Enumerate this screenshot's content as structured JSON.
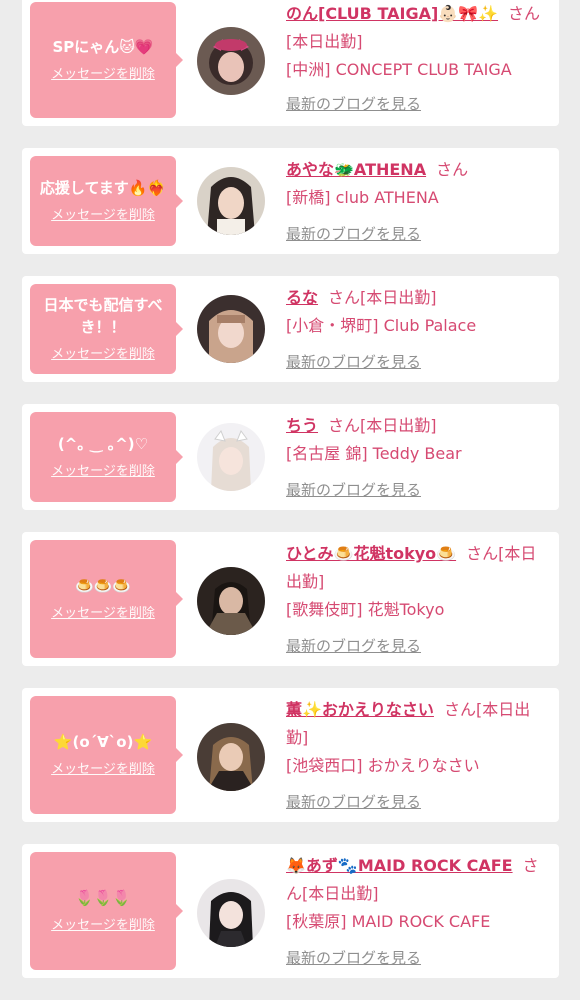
{
  "items": [
    {
      "message": "SPにゃん🐱💗",
      "delete_label": "メッセージを削除",
      "name": "のん[CLUB TAIGA]👶🏻🎀✨",
      "honorific": "さん",
      "status": "[本日出勤]",
      "shop": "[中洲] CONCEPT CLUB TAIGA",
      "blog_link": "最新のブログを見る",
      "avatar": "cast-photo-non"
    },
    {
      "message": "応援してます🔥❤️‍🔥",
      "delete_label": "メッセージを削除",
      "name": "あやな🐲ATHENA",
      "honorific": "さん",
      "status": "",
      "shop": "[新橋] club ATHENA",
      "blog_link": "最新のブログを見る",
      "avatar": "cast-photo-ayana"
    },
    {
      "message": "日本でも配信すべき！！",
      "delete_label": "メッセージを削除",
      "name": "るな",
      "honorific": "さん",
      "status": "[本日出勤]",
      "shop": "[小倉・堺町] Club Palace",
      "blog_link": "最新のブログを見る",
      "avatar": "cast-photo-runa"
    },
    {
      "message": "(^｡ ‿ ｡^)♡",
      "delete_label": "メッセージを削除",
      "name": "ちう",
      "honorific": "さん",
      "status": "[本日出勤]",
      "shop": "[名古屋 錦] Teddy Bear",
      "blog_link": "最新のブログを見る",
      "avatar": "cast-photo-chiu"
    },
    {
      "message": "🍮🍮🍮",
      "delete_label": "メッセージを削除",
      "name": "ひとみ🍮花魁tokyo🍮",
      "honorific": "さん",
      "status": "[本日出勤]",
      "shop": "[歌舞伎町] 花魁Tokyo",
      "blog_link": "最新のブログを見る",
      "avatar": "cast-photo-hitomi"
    },
    {
      "message": "⭐(o´∀`o)⭐",
      "delete_label": "メッセージを削除",
      "name": "薫✨おかえりなさい",
      "honorific": "さん",
      "status": "[本日出勤]",
      "shop": "[池袋西口] おかえりなさい",
      "blog_link": "最新のブログを見る",
      "avatar": "cast-photo-kaoru"
    },
    {
      "message": "🌷🌷🌷",
      "delete_label": "メッセージを削除",
      "name": "🦊あず🐾MAID ROCK CAFE",
      "honorific": "さん",
      "status": "[本日出勤]",
      "shop": "[秋葉原] MAID ROCK CAFE",
      "blog_link": "最新のブログを見る",
      "avatar": "cast-photo-azu"
    }
  ]
}
